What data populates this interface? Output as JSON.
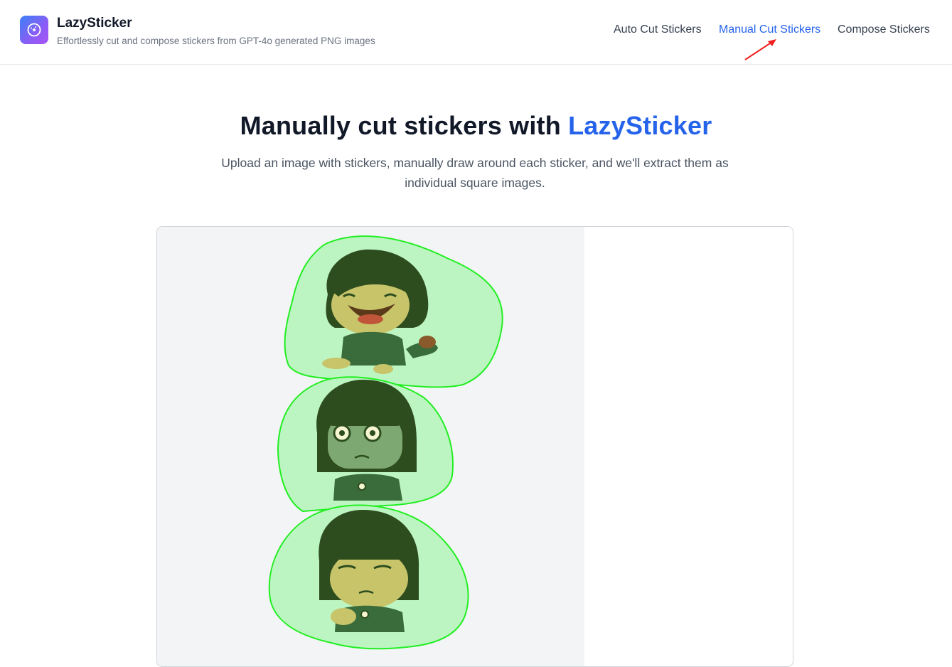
{
  "app": {
    "name": "LazySticker",
    "tagline": "Effortlessly cut and compose stickers from GPT-4o generated PNG images",
    "logo_icon": "palette-icon"
  },
  "nav": {
    "items": [
      {
        "label": "Auto Cut Stickers",
        "active": false
      },
      {
        "label": "Manual Cut Stickers",
        "active": true
      },
      {
        "label": "Compose Stickers",
        "active": false
      }
    ]
  },
  "hero": {
    "title_prefix": "Manually cut stickers with ",
    "title_brand": "LazySticker",
    "description": "Upload an image with stickers, manually draw around each sticker, and we'll extract them as individual square images."
  },
  "editor": {
    "stickers": [
      {
        "description": "laughing-crawling-girl"
      },
      {
        "description": "shocked-girl"
      },
      {
        "description": "sad-thinking-girl"
      }
    ]
  },
  "colors": {
    "accent": "#2563eb",
    "selection_stroke": "#22ee22",
    "selection_fill": "#bdf5c2",
    "canvas_bg": "#f3f4f6",
    "hair": "#2d4d1f",
    "skin": "#c8c46a",
    "shirt": "#3a6b3a"
  }
}
